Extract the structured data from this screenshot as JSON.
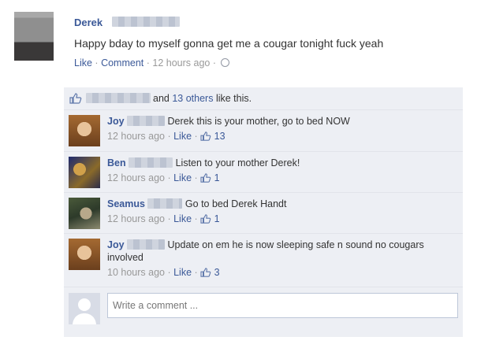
{
  "post": {
    "author": "Derek",
    "text": "Happy bday to myself gonna get me a cougar tonight fuck yeah",
    "actions": {
      "like": "Like",
      "comment": "Comment",
      "time": "12 hours ago"
    }
  },
  "likes": {
    "and_text": "and",
    "others": "13 others",
    "suffix": "like this."
  },
  "comments": [
    {
      "name": "Joy",
      "text": "Derek this is your mother, go to bed NOW",
      "time": "12 hours ago",
      "like": "Like",
      "likes": "13"
    },
    {
      "name": "Ben",
      "text": "Listen to your mother Derek!",
      "time": "12 hours ago",
      "like": "Like",
      "likes": "1"
    },
    {
      "name": "Seamus",
      "text": "Go to bed Derek Handt",
      "time": "12 hours ago",
      "like": "Like",
      "likes": "1"
    },
    {
      "name": "Joy",
      "text": "Update on em he is now sleeping safe n sound no cougars involved",
      "time": "10 hours ago",
      "like": "Like",
      "likes": "3"
    }
  ],
  "composer": {
    "placeholder": "Write a comment ..."
  },
  "colors": {
    "link": "#3b5998",
    "panel": "#edeff4",
    "meta": "#999999"
  },
  "icons": [
    "globe-icon",
    "thumbs-up-icon",
    "default-avatar-icon"
  ]
}
